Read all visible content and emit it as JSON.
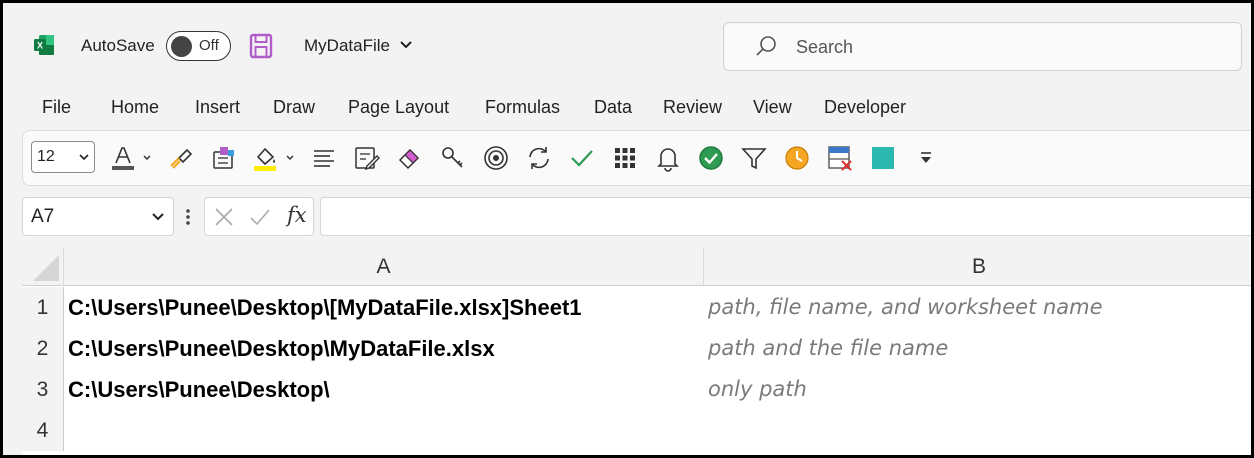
{
  "titlebar": {
    "autosave_label": "AutoSave",
    "autosave_state": "Off",
    "file_name": "MyDataFile"
  },
  "search": {
    "placeholder": "Search"
  },
  "menu": {
    "items": [
      "File",
      "Home",
      "Insert",
      "Draw",
      "Page Layout",
      "Formulas",
      "Data",
      "Review",
      "View",
      "Developer"
    ]
  },
  "toolbar": {
    "font_size": "12",
    "icons": [
      "font-color-icon",
      "format-painter-icon",
      "data-cube-icon",
      "fill-color-icon",
      "align-icon",
      "edit-form-icon",
      "eraser-icon",
      "keys-icon",
      "target-icon",
      "refresh-icon",
      "checkmark-icon",
      "grid-icon",
      "bell-icon",
      "approved-icon",
      "filter-icon",
      "clock-icon",
      "delete-table-icon",
      "teal-square-icon",
      "customize-toolbar-icon"
    ],
    "colors": {
      "font_color_bar": "#555555",
      "fill_color_bar": "#ffee00",
      "teal": "#2bb8ae",
      "green": "#2e9b52",
      "orange": "#f5a623",
      "purple": "#b05cc9"
    }
  },
  "formula_bar": {
    "name_box": "A7",
    "fx": "fx",
    "formula": ""
  },
  "sheet": {
    "columns": [
      "A",
      "B"
    ],
    "rows": [
      {
        "num": "1",
        "a": "C:\\Users\\Punee\\Desktop\\[MyDataFile.xlsx]Sheet1",
        "b": "path, file name, and worksheet name"
      },
      {
        "num": "2",
        "a": "C:\\Users\\Punee\\Desktop\\MyDataFile.xlsx",
        "b": "path and the file name"
      },
      {
        "num": "3",
        "a": "C:\\Users\\Punee\\Desktop\\",
        "b": "only path"
      },
      {
        "num": "4",
        "a": "",
        "b": ""
      }
    ]
  }
}
